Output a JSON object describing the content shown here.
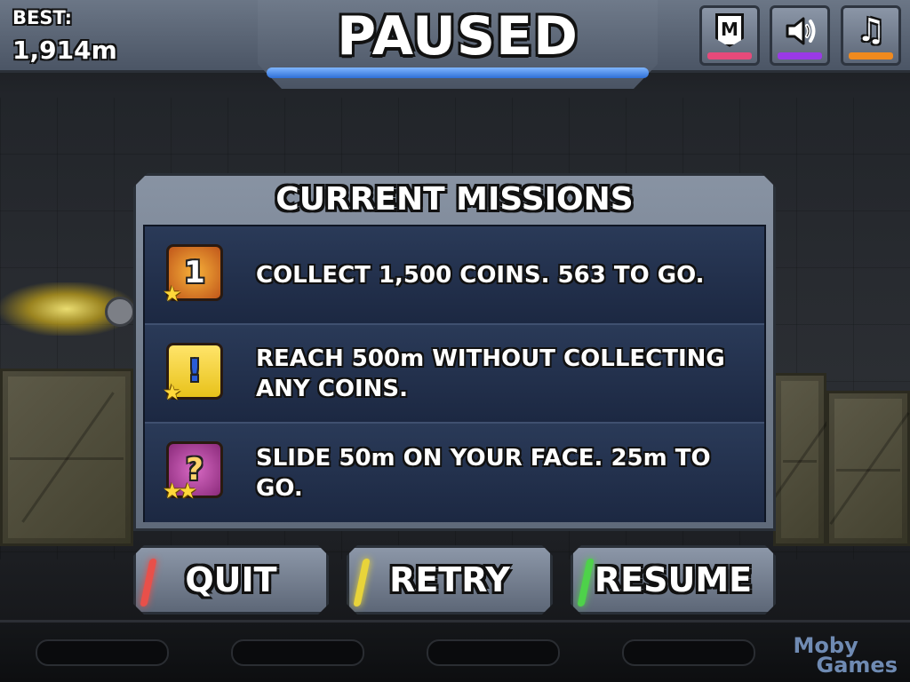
{
  "hud": {
    "best_label": "BEST:",
    "best_value": "1,914m",
    "title": "PAUSED",
    "buttons": [
      {
        "name": "missions-button",
        "icon": "m-badge-icon",
        "glyph": "M",
        "accent": "#e64a7a"
      },
      {
        "name": "sound-button",
        "icon": "speaker-icon",
        "glyph": "🔊",
        "accent": "#9a3ae6"
      },
      {
        "name": "music-button",
        "icon": "music-note-icon",
        "glyph": "♫",
        "accent": "#f08a1e"
      }
    ]
  },
  "missions": {
    "title": "CURRENT MISSIONS",
    "items": [
      {
        "text": "COLLECT 1,500 COINS. 563 TO GO.",
        "icon": "coin-medal-icon",
        "icon_glyph": "1",
        "icon_color": "#e07a1a",
        "stars": "★"
      },
      {
        "text": "REACH 500m WITHOUT COLLECTING ANY COINS.",
        "icon": "warning-sign-icon",
        "icon_glyph": "!",
        "icon_color": "#f2d21a",
        "stars": "★"
      },
      {
        "text": "SLIDE 50m ON YOUR FACE. 25m TO GO.",
        "icon": "lightbulb-question-icon",
        "icon_glyph": "?",
        "icon_color": "#b03a9c",
        "stars": "★★"
      }
    ]
  },
  "actions": {
    "quit": {
      "label": "QUIT",
      "accent": "#e8504a"
    },
    "retry": {
      "label": "RETRY",
      "accent": "#e8d43a"
    },
    "resume": {
      "label": "RESUME",
      "accent": "#4ed24a"
    }
  },
  "watermark": {
    "line1": "Moby",
    "line2": "Games"
  }
}
